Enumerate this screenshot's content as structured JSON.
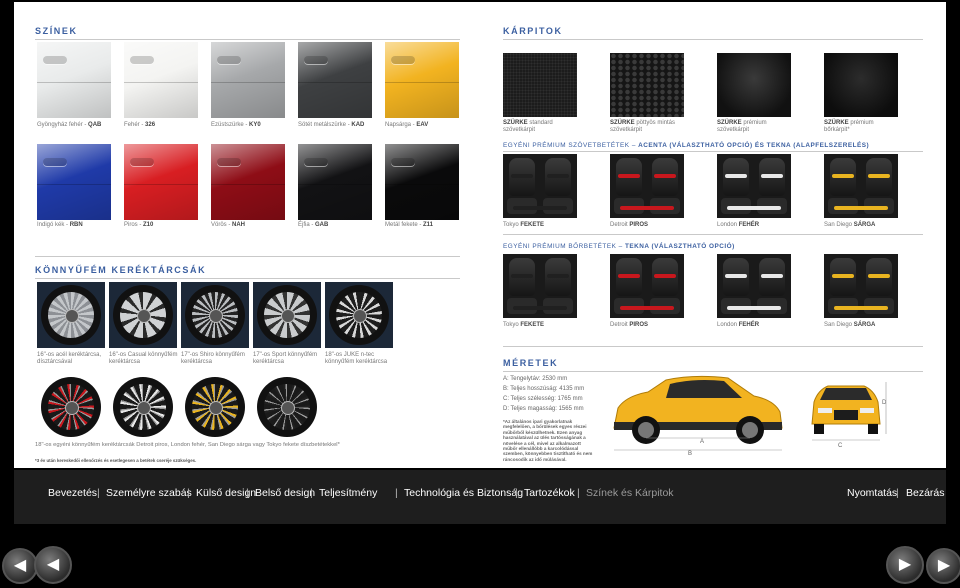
{
  "colors_title": "SZÍNEK",
  "upholstery_title": "KÁRPITOK",
  "paint_colors_row1": [
    {
      "label": "Gyöngyház fehér - ",
      "code": "QAB",
      "hex": "#e9ebeb"
    },
    {
      "label": "Fehér - ",
      "code": "326",
      "hex": "#f4f4f2"
    },
    {
      "label": "Ezüstszürke - ",
      "code": "KY0",
      "hex": "#a6a8aa"
    },
    {
      "label": "Sötét metálszürke - ",
      "code": "KAD",
      "hex": "#3e4042"
    },
    {
      "label": "Napsárga - ",
      "code": "EAV",
      "hex": "#f2b320"
    }
  ],
  "paint_colors_row2": [
    {
      "label": "Indigó kék - ",
      "code": "RBN",
      "hex": "#1f3aa8"
    },
    {
      "label": "Piros - ",
      "code": "Z10",
      "hex": "#d81e22"
    },
    {
      "label": "Vörös - ",
      "code": "NAH",
      "hex": "#8e0d16"
    },
    {
      "label": "Éjfia - ",
      "code": "GAB",
      "hex": "#121214"
    },
    {
      "label": "Metál fekete - ",
      "code": "Z11",
      "hex": "#0a0a0b"
    }
  ],
  "fabric_items": [
    {
      "line1": "SZÜRKE",
      "line1_rest": " standard",
      "line2": "szövetkárpit"
    },
    {
      "line1": "SZÜRKE",
      "line1_rest": " pöttyös mintás",
      "line2": "szövetkárpit"
    },
    {
      "line1": "SZÜRKE",
      "line1_rest": " prémium",
      "line2": "szövetkárpit"
    },
    {
      "line1": "SZÜRKE",
      "line1_rest": " prémium",
      "line2": "bőrkárpit*"
    }
  ],
  "premium_fabric_title": "EGYÉNI PRÉMIUM SZÖVETBETÉTEK – ",
  "premium_fabric_title_rest": "ACENTA (VÁLASZTHATÓ OPCIÓ) ÉS TEKNA (ALAPFELSZERELÉS)",
  "premium_leather_title": "EGYÉNI PRÉMIUM BŐRBETÉTEK – ",
  "premium_leather_title_rest": "TEKNA (VÁLASZTHATÓ OPCIÓ)",
  "accent_items": [
    {
      "city": "Tokyo ",
      "color": "FEKETE",
      "hex": "#202020"
    },
    {
      "city": "Detroit ",
      "color": "PIROS",
      "hex": "#c8171d"
    },
    {
      "city": "London ",
      "color": "FEHÉR",
      "hex": "#e8e8e8"
    },
    {
      "city": "San Diego ",
      "color": "SÁRGA",
      "hex": "#e9b420"
    }
  ],
  "wheels_title": "KÖNNYŰFÉM KERÉKTÁRCSÁK",
  "wheels_row1": [
    {
      "line1": "16\"-os acél keréktárcsa,",
      "line2": "dísztárcsával"
    },
    {
      "line1": "16\"-os Casual könnyűfém",
      "line2": "keréktárcsa"
    },
    {
      "line1": "17\"-os Shiro könnyűfém",
      "line2": "keréktárcsa"
    },
    {
      "line1": "17\"-os Sport könnyűfém",
      "line2": "keréktárcsa"
    },
    {
      "line1": "18\"-os JUKE n-tec",
      "line2": "könnyűfém keréktárcsa"
    }
  ],
  "wheels_row2_caption": "18\"-os egyéni könnyűfém keréktárcsák Detroit piros, London fehér, San Diego sárga vagy Tokyo fekete díszbetétekkel*",
  "footnote": "*3 év után kereskedői ellenőrzés és esetlegesen a betétek cseréje szükséges.",
  "dimensions_title": "MÉRETEK",
  "dimensions": [
    {
      "label": "A: Tengelytáv: ",
      "value": "2530 mm"
    },
    {
      "label": "B: Teljes hosszúság: ",
      "value": "4135 mm"
    },
    {
      "label": "C: Teljes szélesség: ",
      "value": "1765 mm"
    },
    {
      "label": "D: Teljes magasság: ",
      "value": "1565 mm"
    }
  ],
  "dimension_note": "*Az általános ipari gyakorlatnak megfelelően, a bőrülések egyes részei műbőrből készülhetnek. Ezen anyag használatával az ülés tartósságának a növelése a cél, mivel az alkalmazott műbőr ellenállóbb a karcolódással szemben, könnyebben tisztítható és nem ráncosodik az idő múlásával.",
  "dim_letters": {
    "a": "A",
    "b": "B",
    "c": "C",
    "d": "D"
  },
  "nav_items": [
    "Bevezetés",
    "Személyre szabás",
    "Külső design",
    "Belső design",
    "Teljesítmény",
    "Technológia és Biztonság",
    "Tartozékok",
    "Színek és Kárpitok"
  ],
  "nav_active": "Színek és Kárpitok",
  "nav_right": [
    "Nyomtatás",
    "Bezárás"
  ],
  "nav_separator": "|",
  "arrows": {
    "left1": "◀",
    "left2": "◀",
    "right1": "▶",
    "right2": "▶"
  }
}
